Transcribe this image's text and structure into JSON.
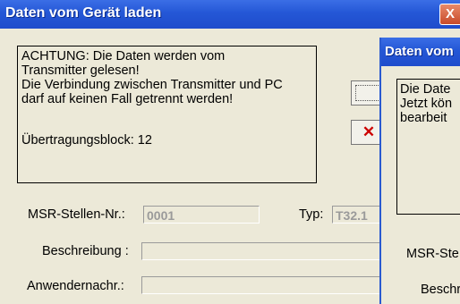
{
  "window": {
    "title": "Daten vom Gerät laden",
    "close_label": "X"
  },
  "message": {
    "lines": [
      "ACHTUNG: Die Daten werden vom",
      "Transmitter gelesen!",
      "Die Verbindung zwischen Transmitter und PC",
      "darf auf keinen Fall getrennt werden!",
      "",
      "Übertragungsblock: 12"
    ]
  },
  "buttons": {
    "cancel_label": "✕"
  },
  "form": {
    "msr_label": "MSR-Stellen-Nr.:",
    "msr_value": "0001",
    "typ_label": "Typ:",
    "typ_value": "T32.1",
    "beschreibung_label": "Beschreibung :",
    "beschreibung_value": "",
    "anwender_label": "Anwendernachr.:",
    "anwender_value": ""
  },
  "second_window": {
    "title": "Daten vom",
    "message_lines": [
      "Die Date",
      "Jetzt kön",
      "bearbeit"
    ],
    "msr_label": "MSR-Ste",
    "beschr_label": "Beschr"
  },
  "colors": {
    "titlebar": "#2457d6",
    "face": "#ece9d8",
    "close": "#c84a2a"
  }
}
